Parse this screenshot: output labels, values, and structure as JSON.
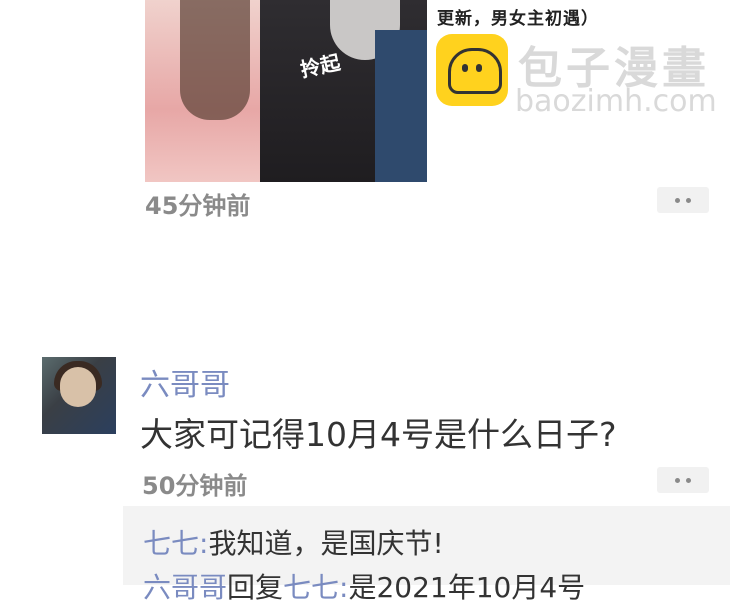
{
  "post_image": {
    "sticker_text": "拎起",
    "caption": "更新，男女主初遇）"
  },
  "watermark": {
    "brand_cn": "包子漫畫",
    "brand_en": "baozimh.com"
  },
  "post1": {
    "timestamp": "45分钟前"
  },
  "comment": {
    "username": "六哥哥",
    "text": "大家可记得10月4号是什么日子?",
    "timestamp": "50分钟前"
  },
  "replies": [
    {
      "name": "七七:",
      "reply_word": "",
      "target": "",
      "text": "我知道，是国庆节!"
    },
    {
      "name": "六哥哥",
      "reply_word": "回复",
      "target": "七七:",
      "text": "是2021年10月4号"
    }
  ]
}
